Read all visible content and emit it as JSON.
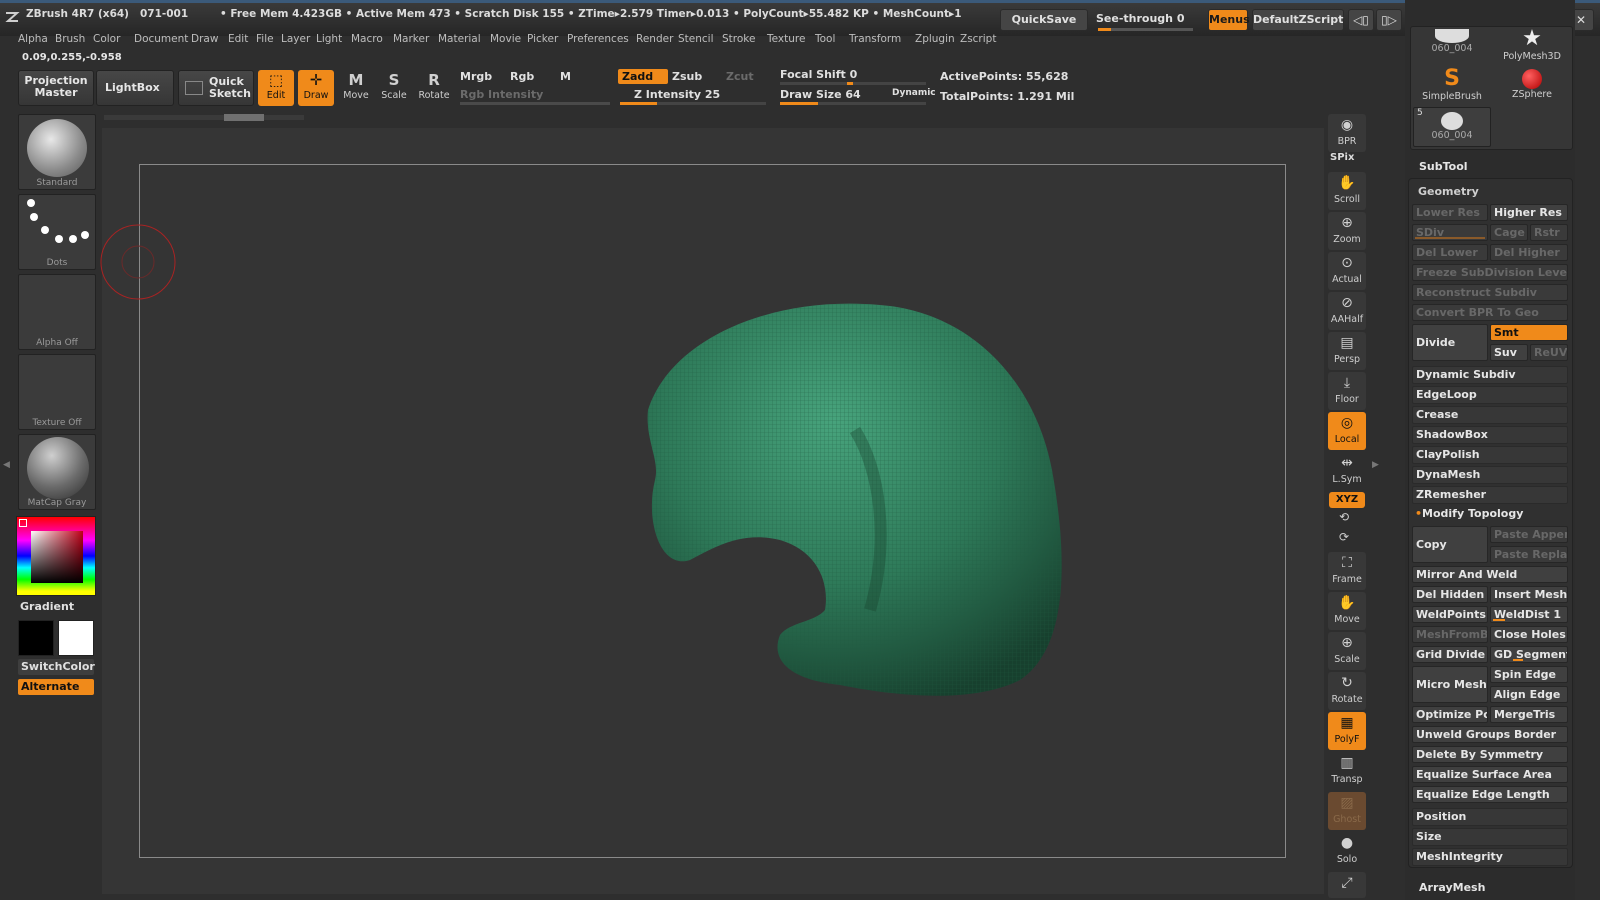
{
  "title": {
    "app": "ZBrush 4R7 (x64)",
    "doc": "071-001",
    "stats": "• Free Mem 4.423GB • Active Mem 473 • Scratch Disk 155 • ZTime▸2.579 Timer▸0.013 • PolyCount▸55.482 KP • MeshCount▸1",
    "quicksave": "QuickSave",
    "seethrough": "See-through  0",
    "seethrough_value": 0,
    "menus": "Menus",
    "script": "DefaultZScript"
  },
  "menubar": [
    "Alpha",
    "Brush",
    "Color",
    "Document",
    "Draw",
    "Edit",
    "File",
    "Layer",
    "Light",
    "Macro",
    "Marker",
    "Material",
    "Movie",
    "Picker",
    "Preferences",
    "Render",
    "Stencil",
    "Stroke",
    "Texture",
    "Tool",
    "Transform",
    "Zplugin",
    "Zscript"
  ],
  "coords": "0.09,0.255,-0.958",
  "toolbar": {
    "projection_master": "Projection Master",
    "lightbox": "LightBox",
    "quick_sketch": "Quick Sketch",
    "edit": "Edit",
    "draw": "Draw",
    "move": "Move",
    "scale": "Scale",
    "rotate": "Rotate",
    "mrgb": "Mrgb",
    "rgb": "Rgb",
    "m": "M",
    "rgb_intensity": "Rgb Intensity",
    "zadd": "Zadd",
    "zsub": "Zsub",
    "zcut": "Zcut",
    "z_intensity": "Z Intensity 25",
    "z_intensity_value": 25,
    "focal_shift": "Focal Shift 0",
    "draw_size": "Draw Size 64",
    "dynamic": "Dynamic",
    "active_points": "ActivePoints: 55,628",
    "total_points": "TotalPoints: 1.291  Mil"
  },
  "leftpanel": {
    "brush": "Standard",
    "stroke": "Dots",
    "alpha": "Alpha  Off",
    "texture": "Texture  Off",
    "material": "MatCap  Gray",
    "gradient": "Gradient",
    "switchcolor": "SwitchColor",
    "alternate": "Alternate"
  },
  "rightstrip": [
    {
      "label": "BPR",
      "icon": "bpr-icon"
    },
    {
      "label": "SPix",
      "icon": "spix-icon"
    },
    {
      "label": "Scroll",
      "icon": "scroll-icon"
    },
    {
      "label": "Zoom",
      "icon": "zoom-icon"
    },
    {
      "label": "Actual",
      "icon": "actual-icon"
    },
    {
      "label": "AAHalf",
      "icon": "aahalf-icon"
    },
    {
      "label": "Persp",
      "icon": "persp-icon"
    },
    {
      "label": "Floor",
      "icon": "floor-icon"
    },
    {
      "label": "Local",
      "icon": "local-icon"
    },
    {
      "label": "L.Sym",
      "icon": "lsym-icon"
    },
    {
      "label": "XYZ",
      "icon": "xyz-icon"
    },
    {
      "label": "Frame",
      "icon": "frame-icon"
    },
    {
      "label": "Move",
      "icon": "move-icon"
    },
    {
      "label": "Scale",
      "icon": "scale-icon"
    },
    {
      "label": "Rotate",
      "icon": "rotate-icon"
    },
    {
      "label": "PolyF",
      "icon": "polyf-icon"
    },
    {
      "label": "Transp",
      "icon": "transp-icon"
    },
    {
      "label": "Ghost",
      "icon": "ghost-icon"
    },
    {
      "label": "Solo",
      "icon": "solo-icon"
    }
  ],
  "toolthumbs": {
    "t1": "060_004",
    "t2": "PolyMesh3D",
    "t3": "SimpleBrush",
    "t4": "ZSphere",
    "t5": "060_004",
    "t5_count": "5"
  },
  "subtool": "SubTool",
  "geometry": {
    "header": "Geometry",
    "lower_res": "Lower Res",
    "higher_res": "Higher Res",
    "sdiv": "SDiv",
    "cage": "Cage",
    "rstr": "Rstr",
    "del_lower": "Del Lower",
    "del_higher": "Del Higher",
    "freeze": "Freeze SubDivision Levels",
    "reconstruct": "Reconstruct Subdiv",
    "convert_bpr": "Convert BPR To Geo",
    "divide": "Divide",
    "smt": "Smt",
    "suv": "Suv",
    "reuv": "ReUV",
    "dynamic_subdiv": "Dynamic Subdiv",
    "edgeloop": "EdgeLoop",
    "crease": "Crease",
    "shadowbox": "ShadowBox",
    "claypolish": "ClayPolish",
    "dynamesh": "DynaMesh",
    "zremesher": "ZRemesher",
    "modify_topology": "Modify Topology",
    "copy": "Copy",
    "paste_append": "Paste Appen",
    "paste_replace": "Paste Replac",
    "mirror_weld": "Mirror And Weld",
    "del_hidden": "Del Hidden",
    "insert_mesh": "Insert Mesh",
    "weldpoints": "WeldPoints",
    "welddist": "WeldDist 1",
    "meshfrombrush": "MeshFromBr",
    "close_holes": "Close Holes",
    "grid_divide": "Grid Divide",
    "gd_segments": "GD Segments",
    "micro_mesh": "Micro Mesh",
    "spin_edge": "Spin Edge",
    "align_edge": "Align Edge",
    "optimize": "Optimize Poi",
    "mergetris": "MergeTris",
    "unweld": "Unweld Groups Border",
    "delete_symmetry": "Delete By Symmetry",
    "equalize_surface": "Equalize Surface Area",
    "equalize_edge": "Equalize Edge Length",
    "position": "Position",
    "size": "Size",
    "meshintegrity": "MeshIntegrity"
  },
  "arraymesh": "ArrayMesh",
  "colors": {
    "accent": "#f08a1a",
    "mesh": "#2f7a5a",
    "background": "#2e2e2e"
  }
}
